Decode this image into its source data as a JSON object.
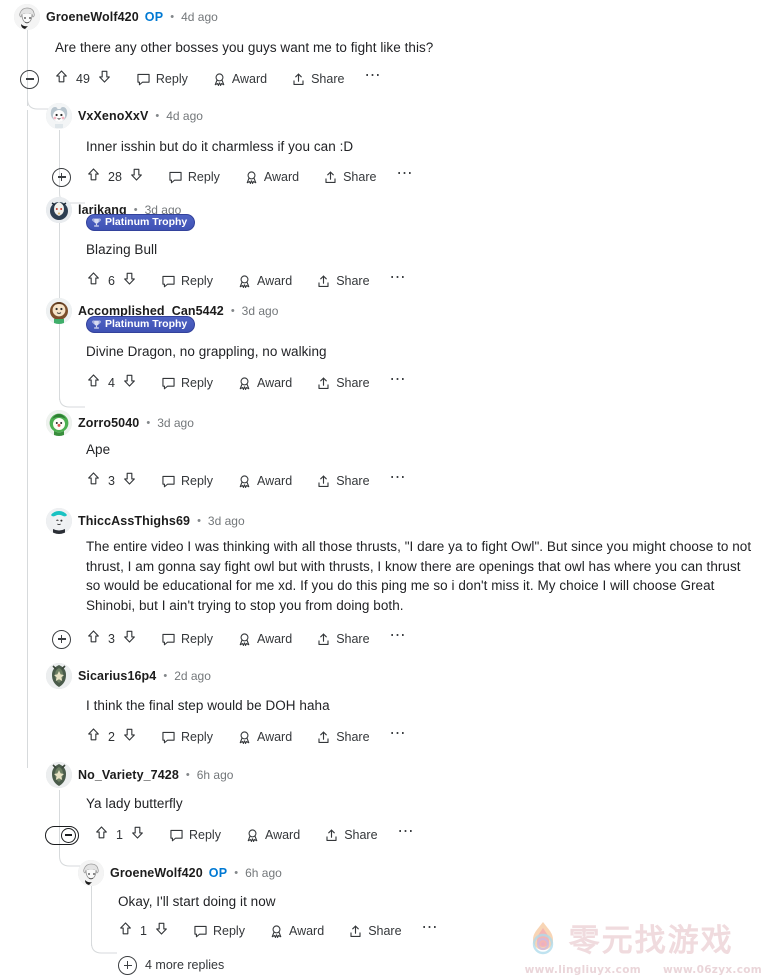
{
  "thread": {
    "comments": [
      {
        "id": "c1",
        "depth": 0,
        "author": "GroeneWolf420",
        "op_label": "OP",
        "is_op": true,
        "age": "4d ago",
        "badge": null,
        "body": "Are there any other bosses you guys want me to fight like this?",
        "collapse": "minus",
        "votes": "49",
        "reply_label": "Reply",
        "award_label": "Award",
        "share_label": "Share"
      },
      {
        "id": "c2",
        "depth": 1,
        "author": "VxXenoXxV",
        "op_label": "",
        "is_op": false,
        "age": "4d ago",
        "badge": null,
        "body": "Inner isshin but do it charmless if you can :D",
        "collapse": "plus",
        "votes": "28",
        "reply_label": "Reply",
        "award_label": "Award",
        "share_label": "Share"
      },
      {
        "id": "c3",
        "depth": 2,
        "author": "larikang",
        "op_label": "",
        "is_op": false,
        "age": "3d ago",
        "badge": "Platinum Trophy",
        "body": "Blazing Bull",
        "collapse": "none",
        "votes": "6",
        "reply_label": "Reply",
        "award_label": "Award",
        "share_label": "Share"
      },
      {
        "id": "c4",
        "depth": 2,
        "author": "Accomplished_Can5442",
        "op_label": "",
        "is_op": false,
        "age": "3d ago",
        "badge": "Platinum Trophy",
        "body": "Divine Dragon, no grappling, no walking",
        "collapse": "none",
        "votes": "4",
        "reply_label": "Reply",
        "award_label": "Award",
        "share_label": "Share"
      },
      {
        "id": "c5",
        "depth": 2,
        "author": "Zorro5040",
        "op_label": "",
        "is_op": false,
        "age": "3d ago",
        "badge": null,
        "body": "Ape",
        "collapse": "none",
        "votes": "3",
        "reply_label": "Reply",
        "award_label": "Award",
        "share_label": "Share"
      },
      {
        "id": "c6",
        "depth": 1,
        "author": "ThiccAssThighs69",
        "op_label": "",
        "is_op": false,
        "age": "3d ago",
        "badge": null,
        "body": "The entire video I was thinking with all those thrusts, \"I dare ya to fight Owl\". But since you might choose to not thrust, I am gonna say fight owl but with thrusts, I know there are openings that owl has where you can thrust so would be educational for me xd. If you do this ping me so i don't miss it. My choice I will choose Great Shinobi, but I ain't trying to stop you from doing both.",
        "collapse": "plus",
        "votes": "3",
        "reply_label": "Reply",
        "award_label": "Award",
        "share_label": "Share"
      },
      {
        "id": "c7",
        "depth": 1,
        "author": "Sicarius16p4",
        "op_label": "",
        "is_op": false,
        "age": "2d ago",
        "badge": null,
        "body": "I think the final step would be DOH haha",
        "collapse": "none",
        "votes": "2",
        "reply_label": "Reply",
        "award_label": "Award",
        "share_label": "Share"
      },
      {
        "id": "c8",
        "depth": 1,
        "author": "No_Variety_7428",
        "op_label": "",
        "is_op": false,
        "age": "6h ago",
        "badge": null,
        "body": "Ya lady butterfly",
        "collapse": "pill",
        "votes": "1",
        "reply_label": "Reply",
        "award_label": "Award",
        "share_label": "Share"
      },
      {
        "id": "c9",
        "depth": 2,
        "author": "GroeneWolf420",
        "op_label": "OP",
        "is_op": true,
        "age": "6h ago",
        "badge": null,
        "body": "Okay, I'll start doing it now",
        "collapse": "none",
        "votes": "1",
        "reply_label": "Reply",
        "award_label": "Award",
        "share_label": "Share"
      }
    ],
    "more_replies_label": "4 more replies"
  },
  "watermark": {
    "brand": "零元找游戏",
    "url_left": "www.lingliuyx.com",
    "url_right": "www.06zyx.com"
  },
  "colors": {
    "op_blue": "#0079d3",
    "badge_blue": "#3f52b5",
    "thread_line": "#d7dadc",
    "text": "#222326",
    "meta": "#73777a"
  }
}
